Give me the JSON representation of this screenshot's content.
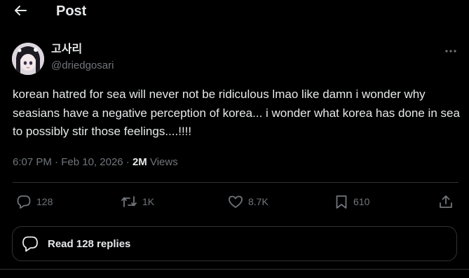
{
  "header": {
    "title": "Post"
  },
  "author": {
    "display_name": "고사리",
    "handle": "@driedgosari"
  },
  "post": {
    "text": "korean hatred for sea will never not be ridiculous lmao like damn i wonder why seasians have a negative perception of korea... i wonder what korea has done in sea to possibly stir those feelings....!!!!",
    "time": "6:07 PM",
    "separator": "·",
    "date": "Feb 10, 2026",
    "views_separator": "·",
    "views_count": "2M",
    "views_label": "Views"
  },
  "actions": {
    "replies": "128",
    "reposts": "1K",
    "likes": "8.7K",
    "bookmarks": "610"
  },
  "replies_button": {
    "label": "Read 128 replies"
  },
  "colors": {
    "background": "#000000",
    "text_primary": "#e7e9ea",
    "text_secondary": "#71767b",
    "border": "#2f3336"
  }
}
